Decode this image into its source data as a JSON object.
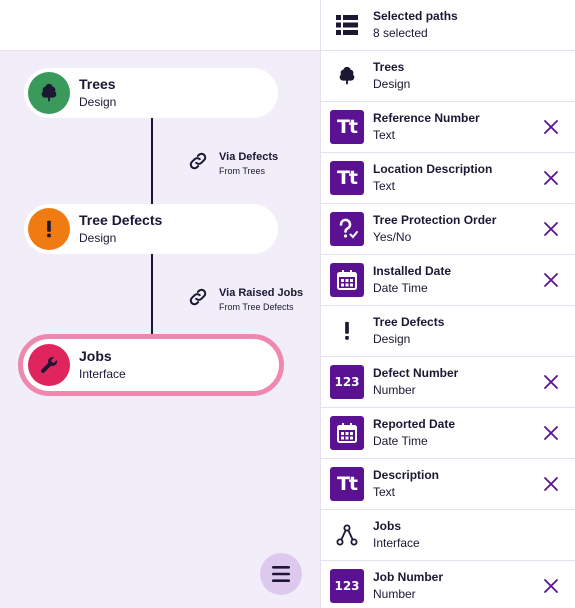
{
  "canvas": {
    "nodes": [
      {
        "title": "Trees",
        "subtitle": "Design",
        "color": "#3a9a5c"
      },
      {
        "title": "Tree Defects",
        "subtitle": "Design",
        "color": "#f07b12"
      },
      {
        "title": "Jobs",
        "subtitle": "Interface",
        "color": "#e0245e"
      }
    ],
    "relations": [
      {
        "name": "Via Defects",
        "from": "From Trees"
      },
      {
        "name": "Via Raised Jobs",
        "from": "From Tree Defects"
      }
    ]
  },
  "panel": {
    "header": {
      "title": "Selected paths",
      "subtitle": "8 selected"
    },
    "rows": [
      {
        "title": "Trees",
        "subtitle": "Design",
        "icon": "tree-icon"
      },
      {
        "title": "Reference Number",
        "subtitle": "Text",
        "icon": "text-type-icon"
      },
      {
        "title": "Location Description",
        "subtitle": "Text",
        "icon": "text-type-icon"
      },
      {
        "title": "Tree Protection Order",
        "subtitle": "Yes/No",
        "icon": "yes-no-type-icon"
      },
      {
        "title": "Installed Date",
        "subtitle": "Date Time",
        "icon": "calendar-icon"
      },
      {
        "title": "Tree Defects",
        "subtitle": "Design",
        "icon": "exclamation-icon"
      },
      {
        "title": "Defect Number",
        "subtitle": "Number",
        "icon": "number-type-icon"
      },
      {
        "title": "Reported Date",
        "subtitle": "Date Time",
        "icon": "calendar-icon"
      },
      {
        "title": "Description",
        "subtitle": "Text",
        "icon": "text-type-icon"
      },
      {
        "title": "Jobs",
        "subtitle": "Interface",
        "icon": "interface-icon"
      },
      {
        "title": "Job Number",
        "subtitle": "Number",
        "icon": "number-type-icon"
      }
    ],
    "text_glyph": "Tt",
    "number_glyph": "123"
  }
}
